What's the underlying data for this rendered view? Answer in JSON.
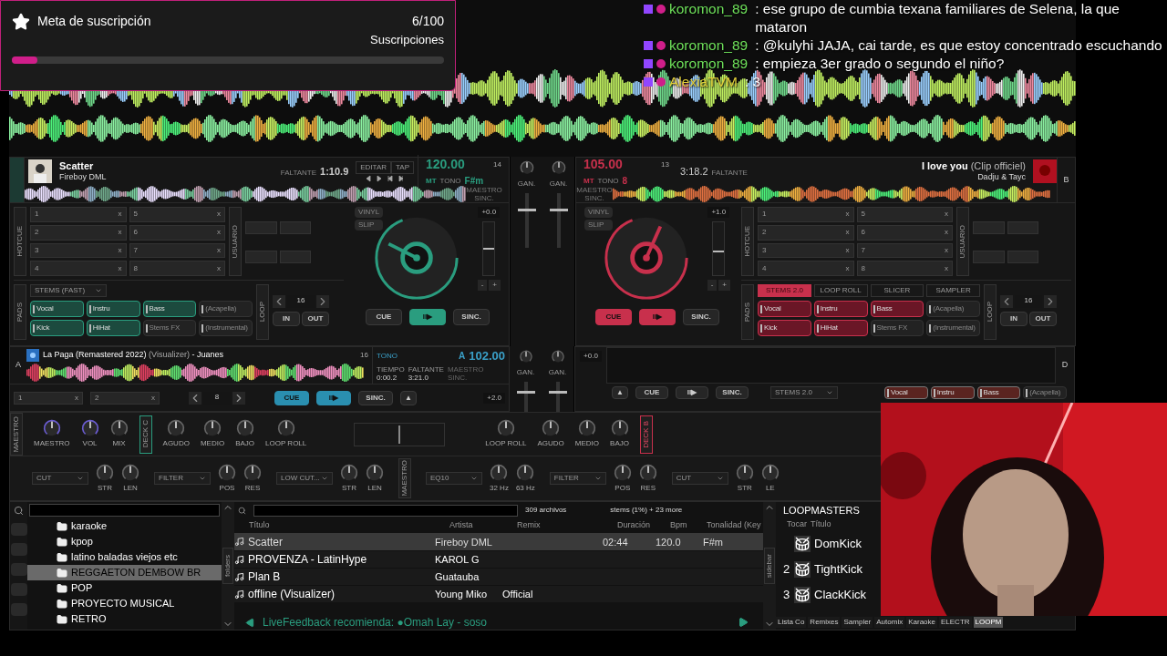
{
  "subscription_goal": {
    "title": "Meta de suscripción",
    "count": "6/100",
    "label": "Suscripciones",
    "level": 0.06
  },
  "chat": [
    {
      "user": "koromon_89",
      "color": "#6ee05a",
      "message": ": ese grupo de cumbia texana familiares de Selena, la que mataron"
    },
    {
      "user": "koromon_89",
      "color": "#6ee05a",
      "message": ": @kulyhi JAJA, cai tarde, es que estoy concentrado escuchando"
    },
    {
      "user": "koromon_89",
      "color": "#6ee05a",
      "message": ": empieza 3er grado o segundo el niño?"
    },
    {
      "user": "AlexiaTVM",
      "color": "#e2cf3a",
      "message": ": 3"
    }
  ],
  "deck_a": {
    "title": "Scatter",
    "artist": "Fireboy DML",
    "remaining_label": "FALTANTE",
    "remaining": "1:10.9",
    "edit": "EDITAR",
    "tap": "TAP",
    "beats": "14",
    "bpm": "120.00",
    "mt": "MT",
    "tone": "TONO",
    "key": "F#m",
    "master_sync": "MAESTRO SINC.",
    "hotcue_label": "HOTCUE",
    "hotcues": [
      {
        "number": "1",
        "clear": "x"
      },
      {
        "number": "5",
        "clear": "x"
      },
      {
        "number": "2",
        "clear": "x"
      },
      {
        "number": "6",
        "clear": "x"
      },
      {
        "number": "3",
        "clear": "x"
      },
      {
        "number": "7",
        "clear": "x"
      },
      {
        "number": "4",
        "clear": "x"
      },
      {
        "number": "8",
        "clear": "x"
      }
    ],
    "user_label": "USUARIO",
    "pads_label": "PADS",
    "pad_mode": "STEMS (FAST)",
    "pads": [
      {
        "label": "Vocal",
        "on": true
      },
      {
        "label": "Instru",
        "on": true
      },
      {
        "label": "Bass",
        "on": true
      },
      {
        "label": "(Acapella)",
        "on": false
      },
      {
        "label": "Kick",
        "on": true
      },
      {
        "label": "HiHat",
        "on": true
      },
      {
        "label": "Stems FX",
        "on": false
      },
      {
        "label": "(Instrumental)",
        "on": false
      }
    ],
    "loop_label": "LOOP",
    "loop_size": "16",
    "loop_in": "IN",
    "loop_out": "OUT",
    "vinyl": "VINYL",
    "slip": "SLIP",
    "pitch": "+0.0",
    "pitch_slider": {
      "level": 0.5
    },
    "pitch_down": "-",
    "pitch_up": "+",
    "cue": "CUE",
    "play": "II▶",
    "sync": "SINC.",
    "cue_on": false,
    "play_on": true
  },
  "deck_b": {
    "letter": "B",
    "title": "I love you",
    "title_extra": "(Clip officiel)",
    "artist": "Dadju & Tayc",
    "remaining_label": "FALTANTE",
    "remaining": "3:18.2",
    "beats": "13",
    "bpm": "105.00",
    "mt": "MT",
    "tone": "TONO",
    "key": "8",
    "master_sync": "MAESTRO SINC.",
    "hotcue_label": "HOTCUE",
    "hotcues": [
      {
        "number": "1",
        "clear": "x"
      },
      {
        "number": "5",
        "clear": "x"
      },
      {
        "number": "2",
        "clear": "x"
      },
      {
        "number": "6",
        "clear": "x"
      },
      {
        "number": "3",
        "clear": "x"
      },
      {
        "number": "7",
        "clear": "x"
      },
      {
        "number": "4",
        "clear": "x"
      },
      {
        "number": "8",
        "clear": "x"
      }
    ],
    "user_label": "USUARIO",
    "pads_label": "PADS",
    "pad_tabs": [
      {
        "label": "STEMS 2.0",
        "selected": true
      },
      {
        "label": "LOOP ROLL",
        "selected": false
      },
      {
        "label": "SLICER",
        "selected": false
      },
      {
        "label": "SAMPLER",
        "selected": false
      }
    ],
    "pads": [
      {
        "label": "Vocal",
        "on": true
      },
      {
        "label": "Instru",
        "on": true
      },
      {
        "label": "Bass",
        "on": true
      },
      {
        "label": "(Acapella)",
        "on": false
      },
      {
        "label": "Kick",
        "on": true
      },
      {
        "label": "HiHat",
        "on": true
      },
      {
        "label": "Stems FX",
        "on": false
      },
      {
        "label": "(Instrumental)",
        "on": false
      }
    ],
    "loop_label": "LOOP",
    "loop_size": "16",
    "loop_in": "IN",
    "loop_out": "OUT",
    "vinyl": "VINYL",
    "slip": "SLIP",
    "pitch": "+1.0",
    "pitch_slider": {
      "level": 0.45
    },
    "pitch_down": "-",
    "pitch_up": "+",
    "cue": "CUE",
    "play": "II▶",
    "sync": "SINC.",
    "cue_on": true,
    "play_on": true
  },
  "mixer_top": [
    {
      "label": "GAN.",
      "level": 0.7
    },
    {
      "label": "GAN.",
      "level": 0.7
    }
  ],
  "deck_c": {
    "letter": "A",
    "title": "La Paga (Remastered 2022)",
    "title_extra": "(Visualizer)",
    "artist": "- Juanes",
    "beats": "16",
    "tone": "TONO",
    "key": "A",
    "bpm": "102.00",
    "time_label": "TIEMPO",
    "time": "0:00.2",
    "remaining_label": "FALTANTE",
    "remaining": "3:21.0",
    "master_sync": "MAESTRO SINC.",
    "pitch": "+2.0",
    "hotcues": [
      {
        "number": "1",
        "clear": "x"
      },
      {
        "number": "2",
        "clear": "x"
      }
    ],
    "loop_size": "8",
    "cue": "CUE",
    "play": "II▶",
    "sync": "SINC.",
    "eject": "▲",
    "cue_on": true,
    "play_on": true
  },
  "mixer_bottom": [
    {
      "label": "GAN.",
      "level": 0.7
    },
    {
      "label": "GAN.",
      "level": 0.7
    }
  ],
  "deck_d": {
    "letter": "D",
    "pitch": "+0.0",
    "eject": "▲",
    "cue": "CUE",
    "play": "II▶",
    "sync": "SINC.",
    "cue_on": false,
    "play_on": false,
    "pad_mode": "STEMS 2.0",
    "pads": [
      {
        "label": "Vocal",
        "on": true
      },
      {
        "label": "Instru",
        "on": true
      },
      {
        "label": "Bass",
        "on": true
      },
      {
        "label": "(Acapella)",
        "on": false
      }
    ]
  },
  "effects_left": {
    "side_label": "MAESTRO",
    "knobs": [
      "MAESTRO",
      "VOL",
      "MIX"
    ],
    "deck_label": "DECK C",
    "eq": [
      "AGUDO",
      "MEDIO",
      "BAJO",
      "LOOP ROLL"
    ]
  },
  "effects_right": {
    "eq": [
      "LOOP ROLL",
      "AGUDO",
      "MEDIO",
      "BAJO"
    ],
    "deck_label": "DECK B"
  },
  "fx_left": [
    {
      "effect": "CUT",
      "knobs": [
        "STR",
        "LEN"
      ]
    },
    {
      "effect": "FILTER",
      "knobs": [
        "POS",
        "RES"
      ]
    },
    {
      "effect": "LOW CUT...",
      "knobs": [
        "STR",
        "LEN"
      ]
    }
  ],
  "fx_master": {
    "label": "MAESTRO",
    "effect": "EQ10",
    "knobs": [
      "32 Hz",
      "63 Hz"
    ]
  },
  "fx_right": [
    {
      "effect": "FILTER",
      "knobs": [
        "POS",
        "RES"
      ]
    },
    {
      "effect": "CUT",
      "knobs": [
        "STR",
        "LE"
      ]
    }
  ],
  "folders": [
    {
      "name": "karaoke",
      "selected": false
    },
    {
      "name": "kpop",
      "selected": false
    },
    {
      "name": "latino baladas viejos etc",
      "selected": false
    },
    {
      "name": "REGGAETON DEMBOW BR",
      "selected": true
    },
    {
      "name": "POP",
      "selected": false
    },
    {
      "name": "PROYECTO MUSICAL",
      "selected": false
    },
    {
      "name": "RETRO",
      "selected": false
    }
  ],
  "folders_tab": "folders",
  "file_count": "309 archivos",
  "filter_info": "stems (1%) + 23 more",
  "columns": [
    "Título",
    "Artista",
    "Remix",
    "Duración",
    "Bpm",
    "Tonalidad (Key"
  ],
  "tracks": [
    {
      "title": "Scatter",
      "artist": "Fireboy DML",
      "duration": "02:44",
      "bpm": "120.0",
      "key": "F#m",
      "selected": true
    },
    {
      "title": "PROVENZA - LatinHype",
      "artist": "KAROL G",
      "selected": false
    },
    {
      "title": "Plan B",
      "artist": "Guatauba",
      "selected": false
    },
    {
      "title": "offline (Visualizer)",
      "artist": "Young Miko",
      "remix": "Official",
      "selected": false
    }
  ],
  "live_feedback": "LiveFeedback recomienda: ●Omah Lay - soso",
  "sidebar_tab": "sidebar",
  "loopmasters": {
    "title": "LOOPMASTERS",
    "columns": [
      "Tocar",
      "Título"
    ],
    "samples": [
      {
        "name": "DomKick"
      },
      {
        "number": "2",
        "name": "TightKick"
      },
      {
        "number": "3",
        "name": "ClackKick"
      }
    ]
  },
  "bottom_tabs": [
    {
      "label": "Lista Co",
      "selected": false
    },
    {
      "label": "Remixes",
      "selected": false
    },
    {
      "label": "Sampler",
      "selected": false
    },
    {
      "label": "Automix",
      "selected": false
    },
    {
      "label": "Karaoke",
      "selected": false
    },
    {
      "label": "ELECTR",
      "selected": false
    },
    {
      "label": "LOOPM",
      "selected": true
    }
  ],
  "webcam": {
    "kind": "picture"
  }
}
